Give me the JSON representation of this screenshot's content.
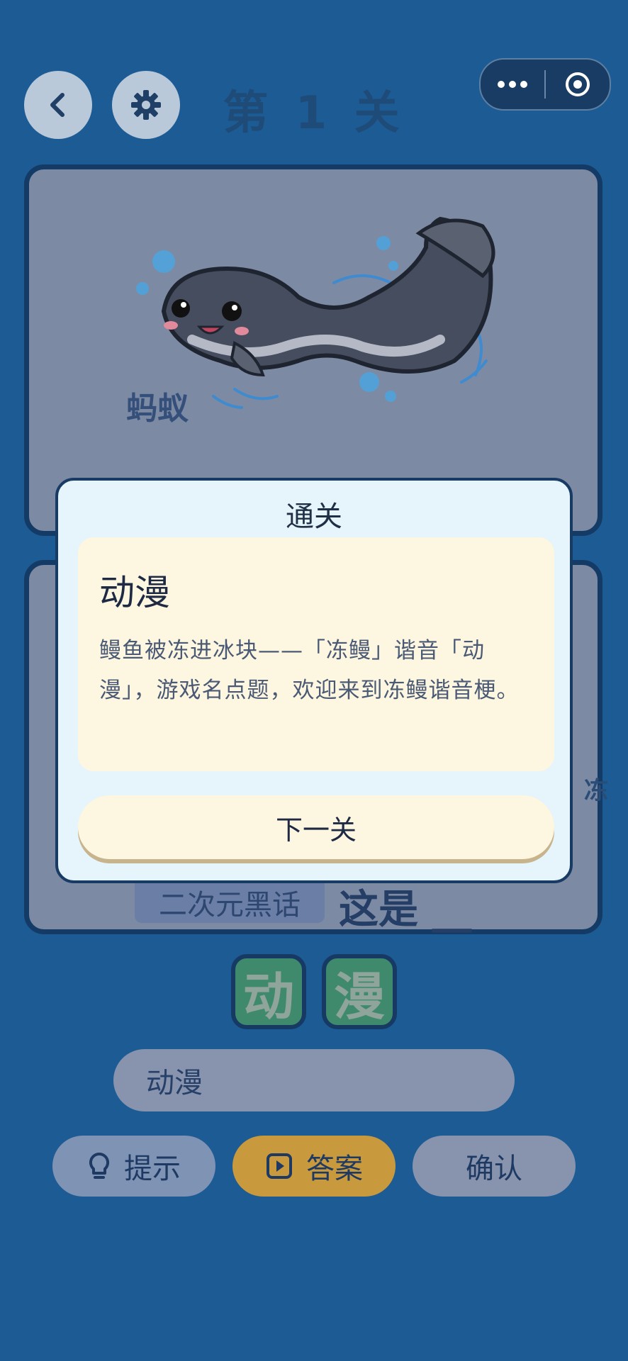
{
  "header": {
    "level_title": "第 1 关",
    "back_icon": "chevron-left-icon",
    "settings_icon": "gear-icon",
    "capsule": {
      "more_icon": "more-dots-icon",
      "close_icon": "target-circle-icon"
    }
  },
  "puzzle": {
    "image_label": "蚂蚁",
    "side_glyph_right": "冻",
    "tag": "二次元黑话",
    "prompt": "这是 __"
  },
  "tiles": [
    "动",
    "漫"
  ],
  "answer_input": {
    "value": "动漫"
  },
  "actions": {
    "hint_label": "提示",
    "answer_label": "答案",
    "confirm_label": "确认"
  },
  "result_dialog": {
    "title": "通关",
    "answer": "动漫",
    "explanation": "鳗鱼被冻进冰块——「冻鳗」谐音「动漫」，游戏名点题，欢迎来到冻鳗谐音梗。",
    "next_label": "下一关"
  },
  "colors": {
    "background": "#1d5b94",
    "card": "#7d8aa4",
    "tile_green": "#3f8a6c",
    "answer_gold": "#c89a3d",
    "dialog": "#e6f4fc",
    "dialog_cream": "#fdf6e0"
  }
}
